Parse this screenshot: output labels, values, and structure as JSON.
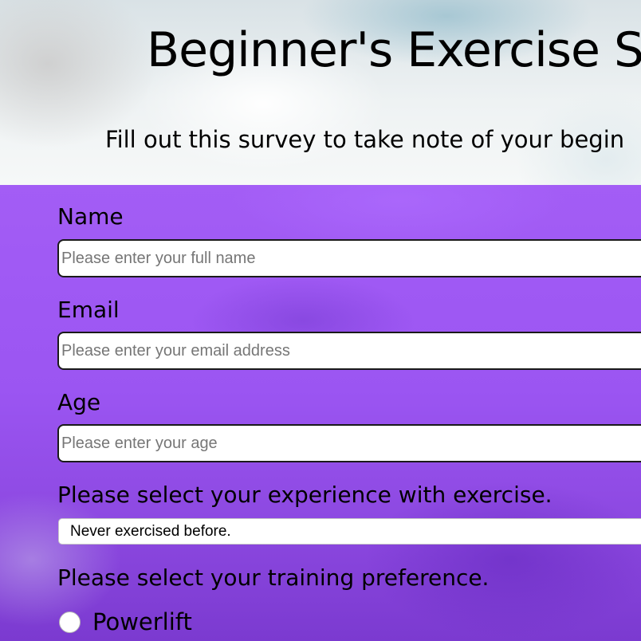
{
  "header": {
    "title": "Beginner's Exercise S",
    "description": "Fill out this survey to take note of your begin"
  },
  "form": {
    "name": {
      "label": "Name",
      "placeholder": "Please enter your full name",
      "value": ""
    },
    "email": {
      "label": "Email",
      "placeholder": "Please enter your email address",
      "value": ""
    },
    "age": {
      "label": "Age",
      "placeholder": "Please enter your age",
      "value": ""
    },
    "experience": {
      "label": "Please select your experience with exercise.",
      "selected": "Never exercised before."
    },
    "training": {
      "label": "Please select your training preference.",
      "options": [
        {
          "label": "Powerlift",
          "checked": false
        }
      ]
    }
  },
  "colors": {
    "form_background": "#9b55f2",
    "header_background": "#eef2f3"
  }
}
